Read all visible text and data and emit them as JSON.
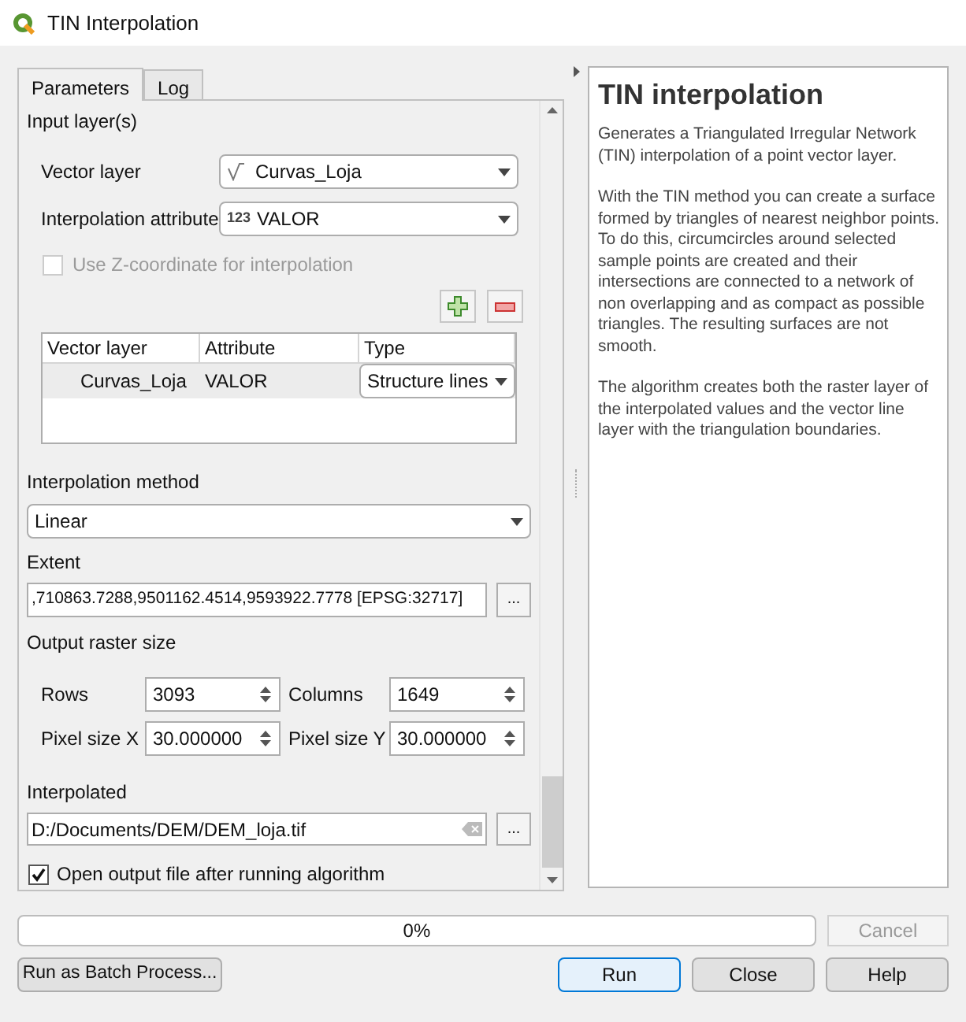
{
  "window": {
    "title": "TIN Interpolation"
  },
  "tabs": [
    {
      "label": "Parameters",
      "selected": true
    },
    {
      "label": "Log",
      "selected": false
    }
  ],
  "input_layers": {
    "heading": "Input layer(s)",
    "vector_layer": {
      "label": "Vector layer",
      "value": "Curvas_Loja"
    },
    "interpolation_attribute": {
      "label": "Interpolation attribute",
      "type_badge": "123",
      "value": "VALOR"
    },
    "use_z": {
      "label": "Use Z-coordinate for interpolation",
      "checked": false,
      "disabled": true
    },
    "table": {
      "columns": [
        "Vector layer",
        "Attribute",
        "Type"
      ],
      "rows": [
        {
          "vector_layer": "Curvas_Loja",
          "attribute": "VALOR",
          "type": "Structure lines",
          "selected": true
        }
      ]
    }
  },
  "interpolation_method": {
    "label": "Interpolation method",
    "value": "Linear"
  },
  "extent": {
    "label": "Extent",
    "value": ",710863.7288,9501162.4514,9593922.7778 [EPSG:32717]",
    "button": "..."
  },
  "output_raster_size": {
    "label": "Output raster size",
    "fields": [
      {
        "label": "Rows",
        "value": "3093"
      },
      {
        "label": "Columns",
        "value": "1649"
      },
      {
        "label": "Pixel size X",
        "value": "30.000000"
      },
      {
        "label": "Pixel size Y",
        "value": "30.000000"
      }
    ]
  },
  "interpolated": {
    "label": "Interpolated",
    "value": "D:/Documents/DEM/DEM_loja.tif",
    "button": "..."
  },
  "open_output": {
    "label": "Open output file after running algorithm",
    "checked": true
  },
  "help": {
    "title": "TIN interpolation",
    "paragraphs": [
      "Generates a Triangulated Irregular Network (TIN) interpolation of a point vector layer.",
      "With the TIN method you can create a surface formed by triangles of nearest neighbor points. To do this, circumcircles around selected sample points are created and their intersections are connected to a network of non overlapping and as compact as possible triangles. The resulting surfaces are not smooth.",
      "The algorithm creates both the raster layer of the interpolated values and the vector line layer with the triangulation boundaries."
    ]
  },
  "progress": {
    "level": 0,
    "text": "0%"
  },
  "cancel": {
    "label": "Cancel",
    "disabled": true
  },
  "batch_button": "Run as Batch Process...",
  "actions": [
    {
      "label": "Run",
      "default": true
    },
    {
      "label": "Close",
      "default": false
    },
    {
      "label": "Help",
      "default": false
    }
  ]
}
